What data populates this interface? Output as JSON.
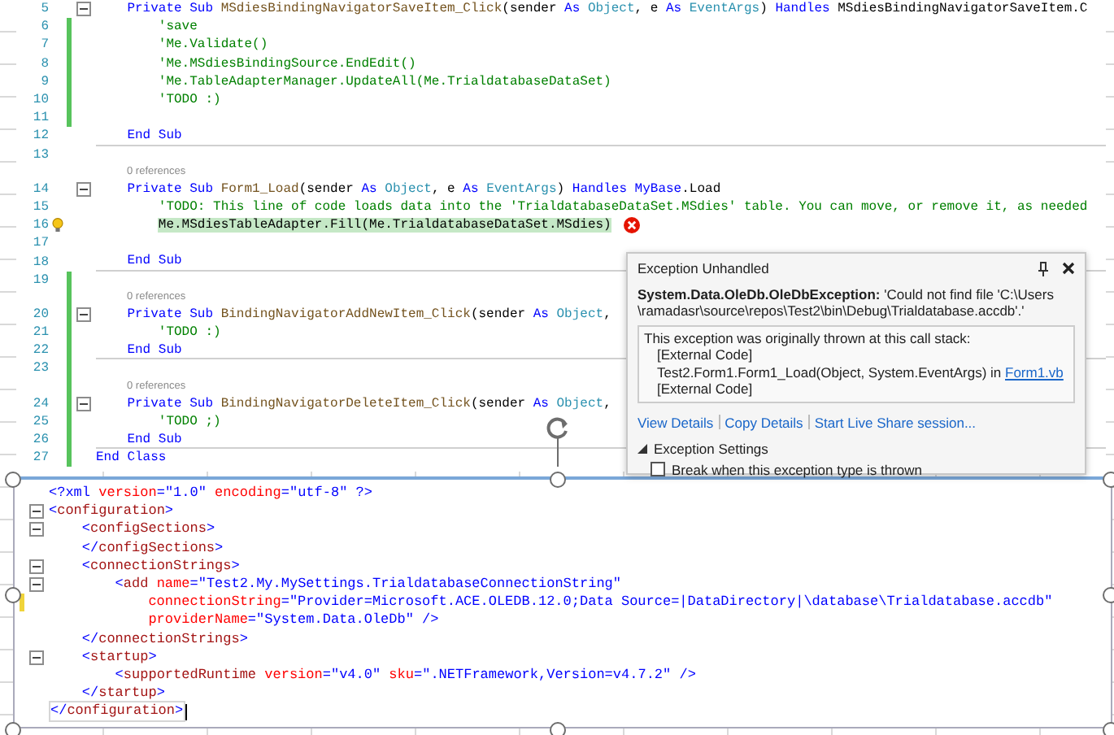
{
  "code_editor": {
    "lines": [
      {
        "number": "5",
        "changed": false,
        "collapsible": true,
        "section_end": false,
        "tokens": [
          {
            "kind": "kw",
            "text": "    Private Sub "
          },
          {
            "kind": "method",
            "text": "MSdiesBindingNavigatorSaveItem_Click"
          },
          {
            "kind": "plain",
            "text": "(sender "
          },
          {
            "kind": "kw",
            "text": "As "
          },
          {
            "kind": "type",
            "text": "Object"
          },
          {
            "kind": "plain",
            "text": ", e "
          },
          {
            "kind": "kw",
            "text": "As "
          },
          {
            "kind": "type",
            "text": "EventArgs"
          },
          {
            "kind": "plain",
            "text": ") "
          },
          {
            "kind": "kw",
            "text": "Handles "
          },
          {
            "kind": "plain",
            "text": "MSdiesBindingNavigatorSaveItem.C"
          }
        ]
      },
      {
        "number": "6",
        "changed": true,
        "collapsible": false,
        "section_end": false,
        "tokens": [
          {
            "kind": "comment",
            "text": "        'save"
          }
        ]
      },
      {
        "number": "7",
        "changed": true,
        "collapsible": false,
        "section_end": false,
        "tokens": [
          {
            "kind": "comment",
            "text": "        'Me.Validate()"
          }
        ]
      },
      {
        "number": "8",
        "changed": true,
        "collapsible": false,
        "section_end": false,
        "tokens": [
          {
            "kind": "comment",
            "text": "        'Me.MSdiesBindingSource.EndEdit()"
          }
        ]
      },
      {
        "number": "9",
        "changed": true,
        "collapsible": false,
        "section_end": false,
        "tokens": [
          {
            "kind": "comment",
            "text": "        'Me.TableAdapterManager.UpdateAll(Me.TrialdatabaseDataSet)"
          }
        ]
      },
      {
        "number": "10",
        "changed": true,
        "collapsible": false,
        "section_end": false,
        "tokens": [
          {
            "kind": "comment",
            "text": "        'TODO :)"
          }
        ]
      },
      {
        "number": "11",
        "changed": true,
        "collapsible": false,
        "section_end": false
      },
      {
        "number": "12",
        "changed": false,
        "collapsible": false,
        "section_end": true,
        "tokens": [
          {
            "kind": "kw",
            "text": "    End Sub"
          }
        ]
      },
      {
        "number": "13",
        "changed": false,
        "collapsible": false,
        "section_end": false
      },
      {
        "number": "14",
        "references": "0 references",
        "changed": false,
        "collapsible": true,
        "section_end": false,
        "tokens": [
          {
            "kind": "kw",
            "text": "    Private Sub "
          },
          {
            "kind": "method",
            "text": "Form1_Load"
          },
          {
            "kind": "plain",
            "text": "(sender "
          },
          {
            "kind": "kw",
            "text": "As "
          },
          {
            "kind": "type",
            "text": "Object"
          },
          {
            "kind": "plain",
            "text": ", e "
          },
          {
            "kind": "kw",
            "text": "As "
          },
          {
            "kind": "type",
            "text": "EventArgs"
          },
          {
            "kind": "plain",
            "text": ") "
          },
          {
            "kind": "kw",
            "text": "Handles "
          },
          {
            "kind": "kw",
            "text": "MyBase"
          },
          {
            "kind": "plain",
            "text": ".Load"
          }
        ]
      },
      {
        "number": "15",
        "changed": false,
        "collapsible": false,
        "section_end": false,
        "tokens": [
          {
            "kind": "comment",
            "text": "        'TODO: This line of code loads data into the 'TrialdatabaseDataSet.MSdies' table. You can move, or remove it, as needed"
          }
        ]
      },
      {
        "number": "16",
        "changed": false,
        "collapsible": false,
        "section_end": false,
        "highlighted": true,
        "error": true,
        "lightbulb": true,
        "tokens": [
          {
            "kind": "plain",
            "text": "        Me.MSdiesTableAdapter.Fill(Me.TrialdatabaseDataSet.MSdies)"
          }
        ]
      },
      {
        "number": "17",
        "changed": false,
        "collapsible": false,
        "section_end": false
      },
      {
        "number": "18",
        "changed": false,
        "collapsible": false,
        "section_end": true,
        "tokens": [
          {
            "kind": "kw",
            "text": "    End Sub"
          }
        ]
      },
      {
        "number": "19",
        "changed": true,
        "collapsible": false,
        "section_end": false
      },
      {
        "number": "20",
        "references": "0 references",
        "changed": true,
        "collapsible": true,
        "section_end": false,
        "tokens": [
          {
            "kind": "kw",
            "text": "    Private Sub "
          },
          {
            "kind": "method",
            "text": "BindingNavigatorAddNewItem_Click"
          },
          {
            "kind": "plain",
            "text": "(sender "
          },
          {
            "kind": "kw",
            "text": "As "
          },
          {
            "kind": "type",
            "text": "Object"
          },
          {
            "kind": "plain",
            "text": ","
          }
        ]
      },
      {
        "number": "21",
        "changed": true,
        "collapsible": false,
        "section_end": false,
        "tokens": [
          {
            "kind": "comment",
            "text": "        'TODO :)"
          }
        ]
      },
      {
        "number": "22",
        "changed": true,
        "collapsible": false,
        "section_end": true,
        "tokens": [
          {
            "kind": "kw",
            "text": "    End Sub"
          }
        ]
      },
      {
        "number": "23",
        "changed": true,
        "collapsible": false,
        "section_end": false
      },
      {
        "number": "24",
        "references": "0 references",
        "changed": true,
        "collapsible": true,
        "section_end": false,
        "tokens": [
          {
            "kind": "kw",
            "text": "    Private Sub "
          },
          {
            "kind": "method",
            "text": "BindingNavigatorDeleteItem_Click"
          },
          {
            "kind": "plain",
            "text": "(sender "
          },
          {
            "kind": "kw",
            "text": "As "
          },
          {
            "kind": "type",
            "text": "Object"
          },
          {
            "kind": "plain",
            "text": ","
          }
        ]
      },
      {
        "number": "25",
        "changed": true,
        "collapsible": false,
        "section_end": false,
        "tokens": [
          {
            "kind": "comment",
            "text": "        'TODO ;)"
          }
        ]
      },
      {
        "number": "26",
        "changed": true,
        "collapsible": false,
        "section_end": true,
        "tokens": [
          {
            "kind": "kw",
            "text": "    End Sub"
          }
        ]
      },
      {
        "number": "27",
        "changed": true,
        "collapsible": false,
        "section_end": false,
        "tokens": [
          {
            "kind": "kw",
            "text": "End Class"
          }
        ]
      }
    ]
  },
  "exception_popup": {
    "title": "Exception Unhandled",
    "message": "**System.Data.OleDb.OleDbException:** 'Could not find file 'C:\\Users \\ramadasr\\source\\repos\\Test2\\bin\\Debug\\Trialdatabase.accdb'.'",
    "call_stack": {
      "heading": "This exception was originally thrown at this call stack:",
      "frames": [
        {
          "text": "[External Code]"
        },
        {
          "text": "Test2.Form1.Form1_Load(Object, System.EventArgs) in ",
          "link": "Form1.vb"
        },
        {
          "text": "[External Code]"
        }
      ]
    },
    "links": [
      "View Details",
      "Copy Details",
      "Start Live Share session..."
    ],
    "settings": {
      "label": "Exception Settings",
      "expanded": true,
      "option": {
        "label": "Break when this exception type is thrown",
        "checked": false
      }
    }
  },
  "xml_editor": {
    "lines": [
      {
        "changed": false,
        "collapsible": false,
        "tokens": [
          {
            "kind": "pun",
            "text": "<?xml"
          },
          {
            "kind": "attr",
            "text": " version"
          },
          {
            "kind": "pun",
            "text": "="
          },
          {
            "kind": "val",
            "text": "\"1.0\""
          },
          {
            "kind": "attr",
            "text": " encoding"
          },
          {
            "kind": "pun",
            "text": "="
          },
          {
            "kind": "val",
            "text": "\"utf-8\""
          },
          {
            "kind": "pun",
            "text": " ?>"
          }
        ]
      },
      {
        "changed": false,
        "collapsible": true,
        "tokens": [
          {
            "kind": "pun",
            "text": "<"
          },
          {
            "kind": "tag",
            "text": "configuration"
          },
          {
            "kind": "pun",
            "text": ">"
          }
        ]
      },
      {
        "changed": false,
        "collapsible": true,
        "tokens": [
          {
            "kind": "pun",
            "text": "    <"
          },
          {
            "kind": "tag",
            "text": "configSections"
          },
          {
            "kind": "pun",
            "text": ">"
          }
        ]
      },
      {
        "changed": false,
        "collapsible": false,
        "tokens": [
          {
            "kind": "pun",
            "text": "    </"
          },
          {
            "kind": "tag",
            "text": "configSections"
          },
          {
            "kind": "pun",
            "text": ">"
          }
        ]
      },
      {
        "changed": false,
        "collapsible": true,
        "tokens": [
          {
            "kind": "pun",
            "text": "    <"
          },
          {
            "kind": "tag",
            "text": "connectionStrings"
          },
          {
            "kind": "pun",
            "text": ">"
          }
        ]
      },
      {
        "changed": false,
        "collapsible": true,
        "tokens": [
          {
            "kind": "pun",
            "text": "        <"
          },
          {
            "kind": "tag",
            "text": "add"
          },
          {
            "kind": "attr",
            "text": " name"
          },
          {
            "kind": "pun",
            "text": "="
          },
          {
            "kind": "val",
            "text": "\"Test2.My.MySettings.TrialdatabaseConnectionString\""
          }
        ]
      },
      {
        "changed": true,
        "collapsible": false,
        "tokens": [
          {
            "kind": "attr",
            "text": "            connectionString"
          },
          {
            "kind": "pun",
            "text": "="
          },
          {
            "kind": "val",
            "text": "\"Provider=Microsoft.ACE.OLEDB.12.0;Data Source=|DataDirectory|\\database\\Trialdatabase.accdb\""
          }
        ]
      },
      {
        "changed": false,
        "collapsible": false,
        "tokens": [
          {
            "kind": "attr",
            "text": "            providerName"
          },
          {
            "kind": "pun",
            "text": "="
          },
          {
            "kind": "val",
            "text": "\"System.Data.OleDb\""
          },
          {
            "kind": "pun",
            "text": " />"
          }
        ]
      },
      {
        "changed": false,
        "collapsible": false,
        "tokens": [
          {
            "kind": "pun",
            "text": "    </"
          },
          {
            "kind": "tag",
            "text": "connectionStrings"
          },
          {
            "kind": "pun",
            "text": ">"
          }
        ]
      },
      {
        "changed": false,
        "collapsible": true,
        "tokens": [
          {
            "kind": "pun",
            "text": "    <"
          },
          {
            "kind": "tag",
            "text": "startup"
          },
          {
            "kind": "pun",
            "text": ">"
          }
        ]
      },
      {
        "changed": false,
        "collapsible": false,
        "tokens": [
          {
            "kind": "pun",
            "text": "        <"
          },
          {
            "kind": "tag",
            "text": "supportedRuntime"
          },
          {
            "kind": "attr",
            "text": " version"
          },
          {
            "kind": "pun",
            "text": "="
          },
          {
            "kind": "val",
            "text": "\"v4.0\""
          },
          {
            "kind": "attr",
            "text": " sku"
          },
          {
            "kind": "pun",
            "text": "="
          },
          {
            "kind": "val",
            "text": "\".NETFramework,Version=v4.7.2\""
          },
          {
            "kind": "pun",
            "text": " />"
          }
        ]
      },
      {
        "changed": false,
        "collapsible": false,
        "tokens": [
          {
            "kind": "pun",
            "text": "    </"
          },
          {
            "kind": "tag",
            "text": "startup"
          },
          {
            "kind": "pun",
            "text": ">"
          }
        ]
      },
      {
        "changed": false,
        "collapsible": false,
        "current": true,
        "tokens": [
          {
            "kind": "pun",
            "text": "</"
          },
          {
            "kind": "tag",
            "text": "configuration"
          },
          {
            "kind": "pun",
            "text": ">"
          }
        ]
      }
    ]
  }
}
